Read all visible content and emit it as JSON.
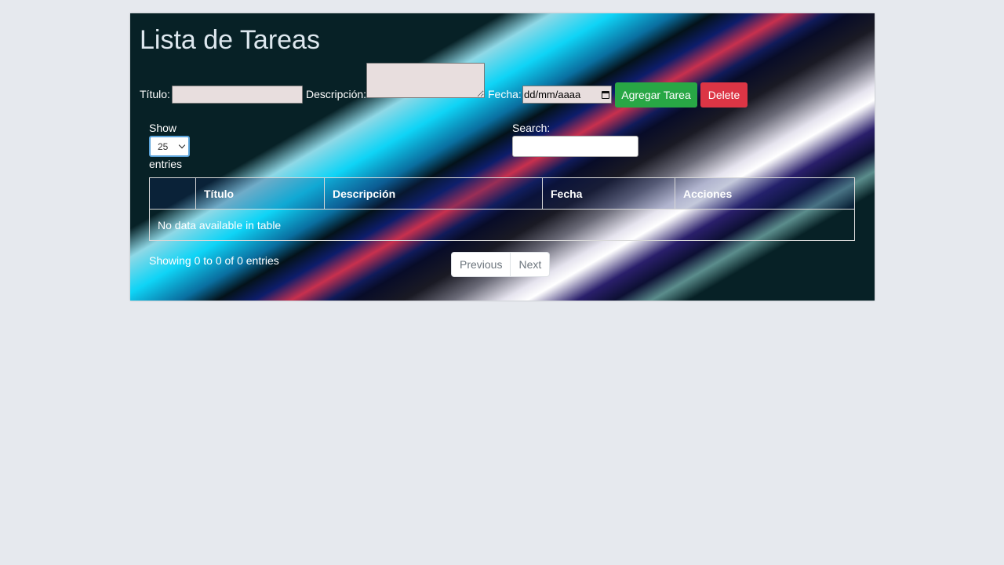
{
  "page": {
    "title": "Lista de Tareas"
  },
  "form": {
    "titulo_label": "Título:",
    "titulo_value": "",
    "descripcion_label": "Descripción:",
    "descripcion_value": "",
    "fecha_label": "Fecha:",
    "fecha_placeholder": "dd/mm/aaaa",
    "add_button": "Agregar Tarea",
    "delete_button": "Delete"
  },
  "datatable": {
    "length_label_before": "Show",
    "length_value": "25",
    "length_label_after": "entries",
    "search_label": "Search:",
    "search_value": "",
    "columns": [
      "",
      "Título",
      "Descripción",
      "Fecha",
      "Acciones"
    ],
    "empty_message": "No data available in table",
    "info": "Showing 0 to 0 of 0 entries",
    "pagination": {
      "previous": "Previous",
      "next": "Next"
    }
  },
  "colors": {
    "add_button": "#28a745",
    "delete_button": "#dc3545",
    "page_background": "#e6e9ee"
  }
}
